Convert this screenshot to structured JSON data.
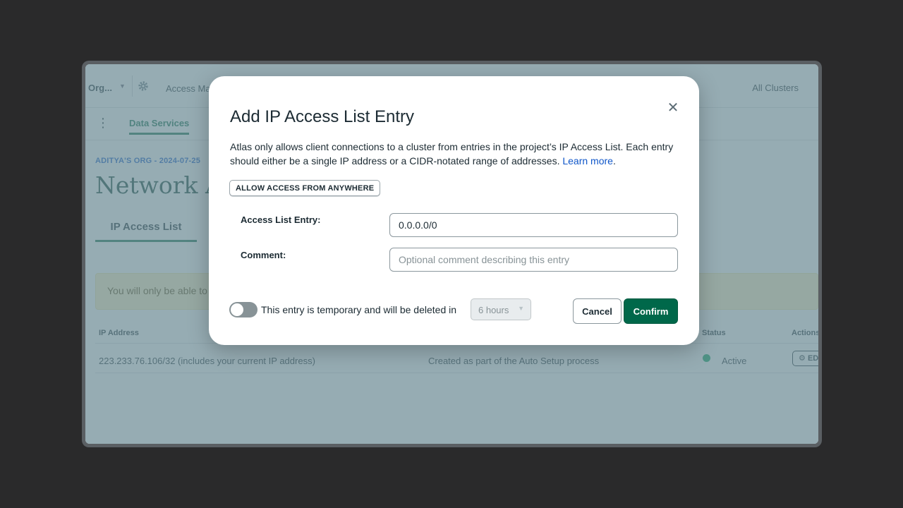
{
  "background": {
    "org_label": "Org...",
    "access_menu_label": "Access Ma",
    "all_clusters_label": "All Clusters",
    "data_services_tab": "Data Services",
    "breadcrumb": "ADITYA'S ORG - 2024-07-25",
    "page_title": "Network Ac",
    "ip_access_tab": "IP Access List",
    "banner_text": "You will only be able to",
    "table": {
      "headers": {
        "ip_address": "IP Address",
        "status": "Status",
        "actions": "Actions"
      },
      "row": {
        "ip": "223.233.76.106/32  (includes your current IP address)",
        "comment": "Created as part of the Auto Setup process",
        "status": "Active",
        "action": "ED"
      }
    }
  },
  "modal": {
    "title": "Add IP Access List Entry",
    "description": "Atlas only allows client connections to a cluster from entries in the project’s IP Access List. Each entry should either be a single IP address or a CIDR-notated range of addresses.",
    "learn_more": "Learn more",
    "allow_anywhere_label": "ALLOW ACCESS FROM ANYWHERE",
    "access_entry_label": "Access List Entry:",
    "access_entry_value": "0.0.0.0/0",
    "comment_label": "Comment:",
    "comment_placeholder": "Optional comment describing this entry",
    "temporary_label": "This entry is temporary and will be deleted in",
    "duration_value": "6 hours",
    "cancel_label": "Cancel",
    "confirm_label": "Confirm"
  },
  "colors": {
    "accent_green": "#00684a",
    "link_blue": "#0f56c9",
    "status_active": "#00a35c"
  }
}
